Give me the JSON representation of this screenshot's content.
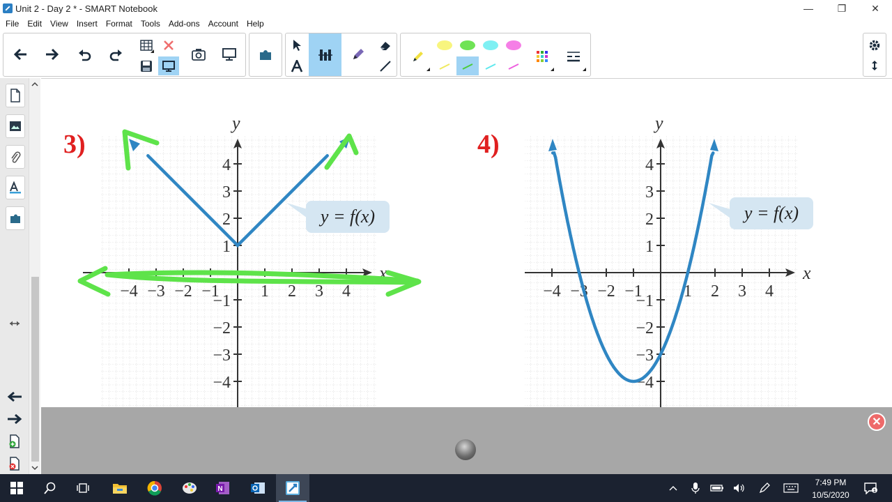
{
  "window": {
    "title": "Unit 2 - Day 2 * - SMART Notebook",
    "minimize": "—",
    "restore": "❐",
    "close": "✕"
  },
  "menu": [
    "File",
    "Edit",
    "View",
    "Insert",
    "Format",
    "Tools",
    "Add-ons",
    "Account",
    "Help"
  ],
  "problems": {
    "p3": {
      "label": "3)",
      "function_label": "y = f(x)",
      "y_axis": "y",
      "x_axis": "x"
    },
    "p4": {
      "label": "4)",
      "function_label": "y = f(x)",
      "y_axis": "y",
      "x_axis": "x"
    }
  },
  "ticks": {
    "x": [
      "−4",
      "−3",
      "−2",
      "−1",
      "1",
      "2",
      "3",
      "4"
    ],
    "y_pos": [
      "4",
      "3",
      "2",
      "1"
    ],
    "y_neg": [
      "−1",
      "−2",
      "−3",
      "−4"
    ]
  },
  "chart_data": [
    {
      "type": "line",
      "title": "3)",
      "xlabel": "x",
      "ylabel": "y",
      "xlim": [
        -4,
        4
      ],
      "ylim": [
        -4,
        4
      ],
      "grid": true,
      "series": [
        {
          "name": "y = f(x)",
          "x": [
            -4,
            -3,
            -2,
            -1,
            0,
            1,
            2,
            3,
            4
          ],
          "y": [
            5,
            4,
            3,
            2,
            1,
            2,
            3,
            4,
            5
          ]
        }
      ],
      "annotations": [
        "green ink arrows on both ends of the graph and along the x-axis"
      ]
    },
    {
      "type": "line",
      "title": "4)",
      "xlabel": "x",
      "ylabel": "y",
      "xlim": [
        -4,
        4
      ],
      "ylim": [
        -4,
        4
      ],
      "grid": true,
      "series": [
        {
          "name": "y = f(x)",
          "x": [
            -4,
            -3,
            -2,
            -1,
            0,
            1,
            2
          ],
          "y": [
            5,
            0,
            -3,
            -4,
            -3,
            0,
            5
          ]
        }
      ]
    }
  ],
  "colors": {
    "curve": "#2f86c3",
    "ink_green": "#5ee34a",
    "problem_label": "#e02020",
    "toolbar_active": "#9fd3f4",
    "taskbar": "#1b2230"
  },
  "taskbar": {
    "icons": [
      "windows-start-icon",
      "search-icon",
      "task-view-icon",
      "file-explorer-icon",
      "chrome-icon",
      "paint-icon",
      "onenote-icon",
      "outlook-icon",
      "smart-notebook-icon"
    ],
    "time": "7:49 PM",
    "date": "10/5/2020"
  }
}
